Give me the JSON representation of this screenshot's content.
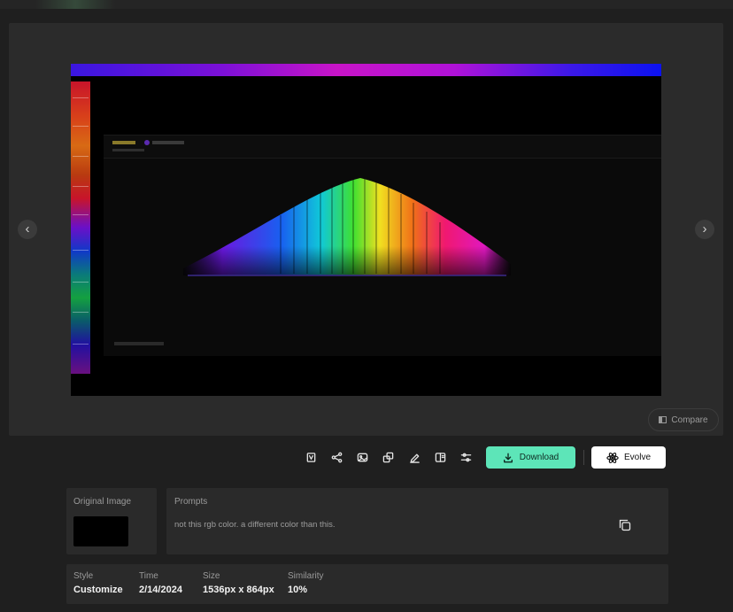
{
  "viewer": {
    "prev_label": "‹",
    "next_label": "›",
    "compare_label": "Compare"
  },
  "toolbar": {
    "tools": [
      "bookmark-icon",
      "share-icon",
      "image-icon",
      "upscale-icon",
      "edit-icon",
      "split-icon",
      "adjust-icon"
    ],
    "download_label": "Download",
    "evolve_label": "Evolve",
    "download_color": "#5de5b8"
  },
  "original": {
    "label": "Original Image"
  },
  "prompts": {
    "label": "Prompts",
    "text": "not this rgb color. a different color than this."
  },
  "meta": {
    "style_label": "Style",
    "style_value": "Customize",
    "time_label": "Time",
    "time_value": "2/14/2024",
    "size_label": "Size",
    "size_value": "1536px x 864px",
    "similarity_label": "Similarity",
    "similarity_value": "10%"
  }
}
